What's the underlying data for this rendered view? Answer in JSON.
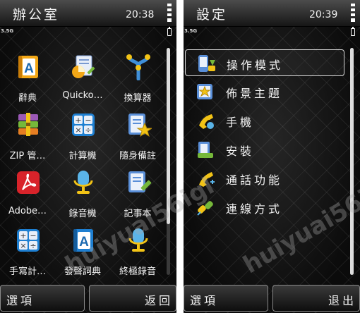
{
  "left_screen": {
    "title": "辦公室",
    "clock": "20:38",
    "network": "3.5G",
    "apps": [
      {
        "label": "辭典",
        "icon": "dictionary-icon"
      },
      {
        "label": "Quicko…",
        "icon": "quickoffice-icon"
      },
      {
        "label": "換算器",
        "icon": "converter-icon"
      },
      {
        "label": "ZIP 管…",
        "icon": "zip-manager-icon"
      },
      {
        "label": "計算機",
        "icon": "calculator-icon"
      },
      {
        "label": "隨身備註",
        "icon": "active-notes-icon"
      },
      {
        "label": "Adobe…",
        "icon": "adobe-reader-icon"
      },
      {
        "label": "錄音機",
        "icon": "recorder-icon"
      },
      {
        "label": "記事本",
        "icon": "notes-icon"
      },
      {
        "label": "手寫計…",
        "icon": "handwriting-calculator-icon"
      },
      {
        "label": "發聲詞典",
        "icon": "talking-dictionary-icon"
      },
      {
        "label": "終極錄音",
        "icon": "ultimate-recorder-icon"
      }
    ],
    "softkeys": {
      "left": "選項",
      "right": "返回"
    }
  },
  "right_screen": {
    "title": "設定",
    "clock": "20:39",
    "network": "3.5G",
    "items": [
      {
        "label": "操作模式",
        "icon": "profiles-icon",
        "selected": true
      },
      {
        "label": "佈景主題",
        "icon": "themes-icon",
        "selected": false
      },
      {
        "label": "手機",
        "icon": "phone-icon",
        "selected": false
      },
      {
        "label": "安裝",
        "icon": "installations-icon",
        "selected": false
      },
      {
        "label": "通話功能",
        "icon": "call-settings-icon",
        "selected": false
      },
      {
        "label": "連線方式",
        "icon": "connectivity-icon",
        "selected": false
      }
    ],
    "softkeys": {
      "left": "選項",
      "right": "退出"
    }
  },
  "watermark": "huiyuai56igl",
  "colors": {
    "background": "#0b0b0b",
    "text": "#f4f4f4",
    "accent": "#f0b429"
  }
}
